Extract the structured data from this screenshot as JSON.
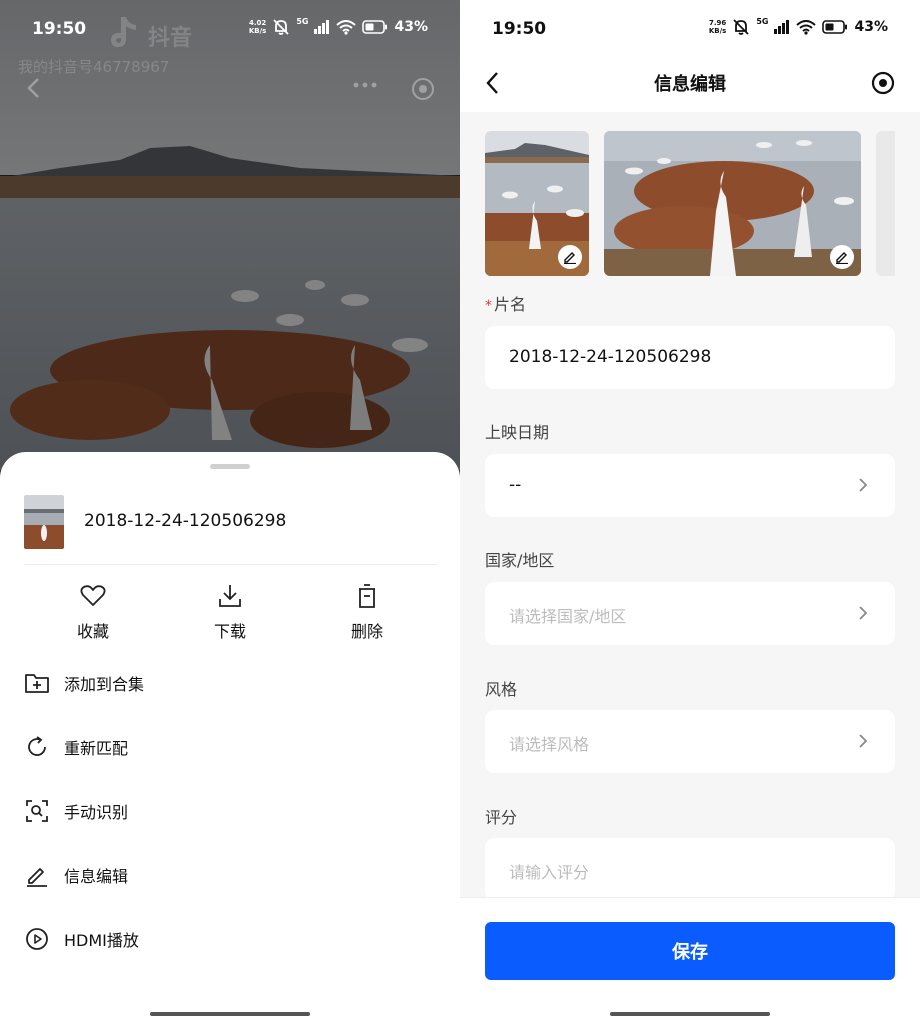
{
  "left": {
    "status_bar": {
      "time": "19:50",
      "speed": "4.02",
      "speed_unit": "KB/s",
      "network": "5G",
      "battery": "43%"
    },
    "watermark": {
      "brand": "抖音",
      "account": "我的抖音号46778967"
    },
    "sheet": {
      "file_name": "2018-12-24-120506298",
      "actions": [
        {
          "label": "收藏",
          "icon": "heart-icon"
        },
        {
          "label": "下载",
          "icon": "download-icon"
        },
        {
          "label": "删除",
          "icon": "trash-icon"
        }
      ],
      "menu": [
        {
          "label": "添加到合集",
          "icon": "folder-add-icon"
        },
        {
          "label": "重新匹配",
          "icon": "refresh-icon"
        },
        {
          "label": "手动识别",
          "icon": "scan-search-icon"
        },
        {
          "label": "信息编辑",
          "icon": "pencil-icon"
        },
        {
          "label": "HDMI播放",
          "icon": "play-circle-icon"
        }
      ]
    }
  },
  "right": {
    "status_bar": {
      "time": "19:50",
      "speed": "7.96",
      "speed_unit": "KB/s",
      "network": "5G",
      "battery": "43%"
    },
    "header": {
      "title": "信息编辑"
    },
    "form": {
      "title_label": "片名",
      "title_required_mark": "*",
      "title_value": "2018-12-24-120506298",
      "release_label": "上映日期",
      "release_value": "--",
      "country_label": "国家/地区",
      "country_placeholder": "请选择国家/地区",
      "style_label": "风格",
      "style_placeholder": "请选择风格",
      "rating_label": "评分",
      "rating_placeholder": "请输入评分"
    },
    "save_label": "保存",
    "accent_color": "#0a5cff"
  }
}
